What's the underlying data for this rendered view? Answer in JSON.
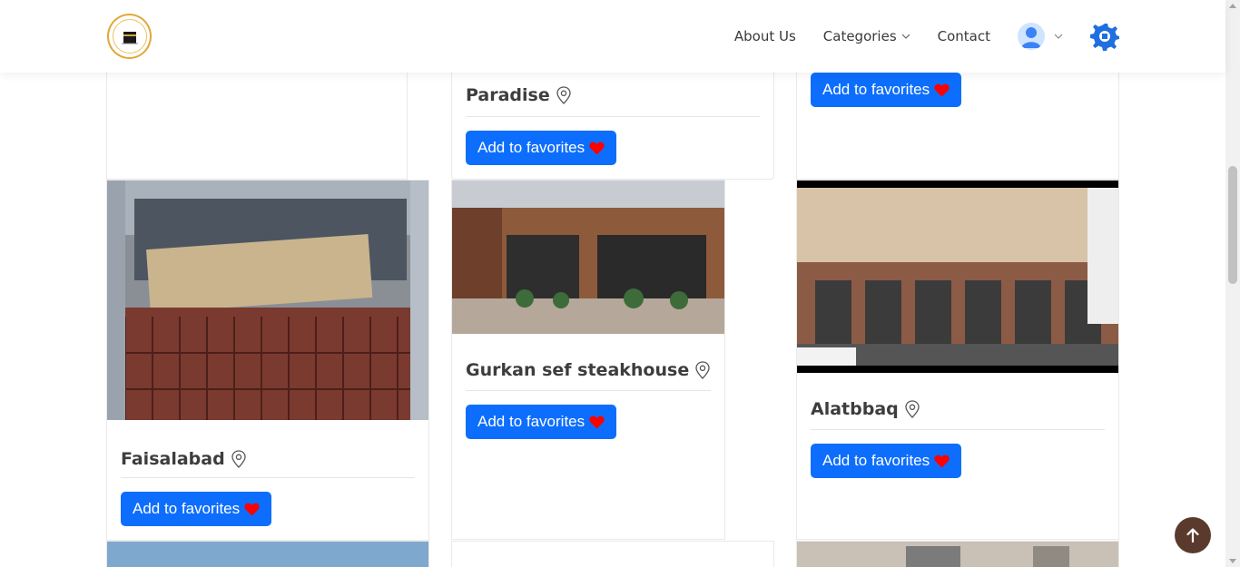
{
  "header": {
    "nav": [
      {
        "label": "About Us"
      },
      {
        "label": "Categories"
      },
      {
        "label": "Contact"
      }
    ]
  },
  "cards": {
    "paradise": {
      "title": "Paradise",
      "button": "Add to favorites"
    },
    "top_right": {
      "button": "Add to favorites"
    },
    "faisalabad": {
      "title": "Faisalabad",
      "button": "Add to favorites"
    },
    "gurkan": {
      "title": "Gurkan sef steakhouse",
      "button": "Add to favorites"
    },
    "alatbbaq": {
      "title": "Alatbbaq",
      "button": "Add to favorites"
    }
  },
  "colors": {
    "button": "#0d6efd",
    "heart": "#ff0000",
    "back_to_top": "#5b3a2e",
    "logo_ring": "#e0a83a"
  },
  "icons": {
    "location": "location-pin-icon",
    "favorite": "heart-icon",
    "settings": "gear-icon",
    "user": "user-avatar-icon",
    "back_to_top": "arrow-up-icon"
  }
}
